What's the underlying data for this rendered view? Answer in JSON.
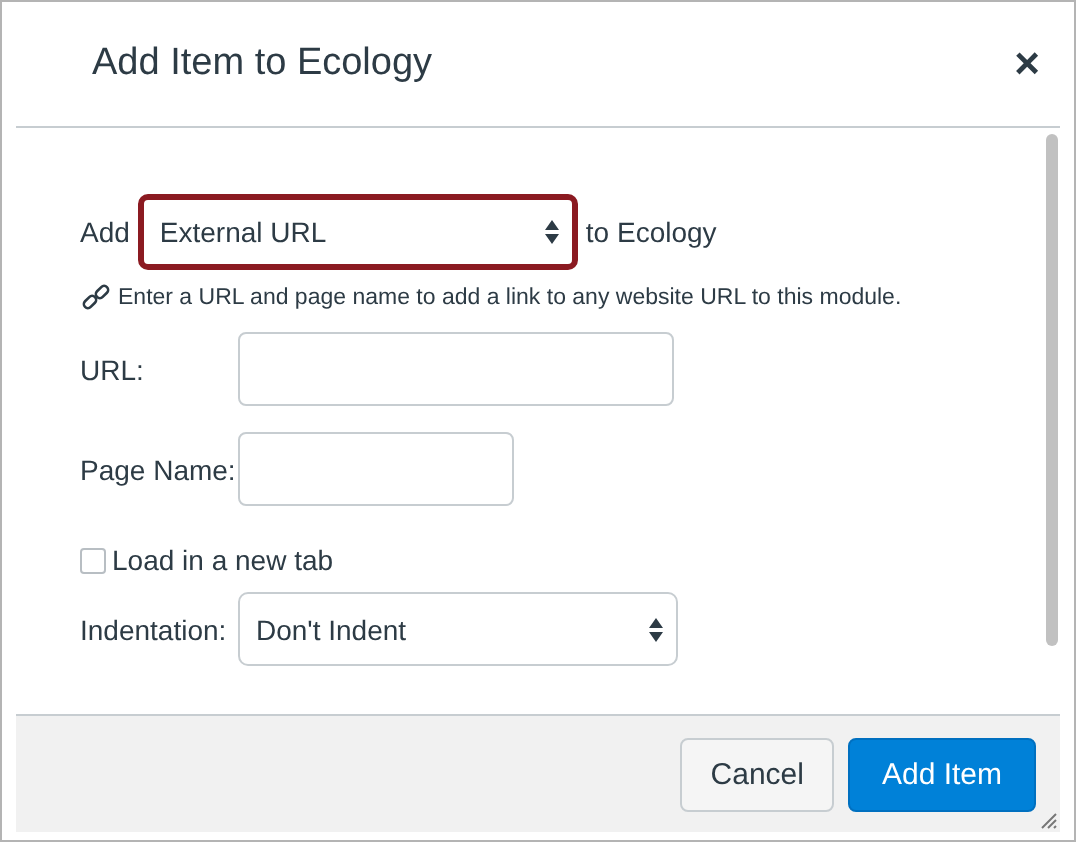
{
  "dialog": {
    "title": "Add Item to Ecology",
    "close": "×"
  },
  "add_row": {
    "prefix": "Add",
    "type_select": {
      "value": "External URL",
      "focused": true
    },
    "suffix": "to Ecology"
  },
  "hint": "Enter a URL and page name to add a link to any website URL to this module.",
  "fields": [
    {
      "label": "URL:",
      "kind": "wide"
    },
    {
      "label": "Page Name:",
      "kind": "narrow"
    }
  ],
  "new_tab": {
    "label": "Load in a new tab",
    "checked": false
  },
  "indentation": {
    "label": "Indentation:",
    "value": "Don't Indent"
  },
  "buttons": [
    {
      "label": "Cancel",
      "kind": "secondary"
    },
    {
      "label": "Add Item",
      "kind": "primary"
    }
  ]
}
